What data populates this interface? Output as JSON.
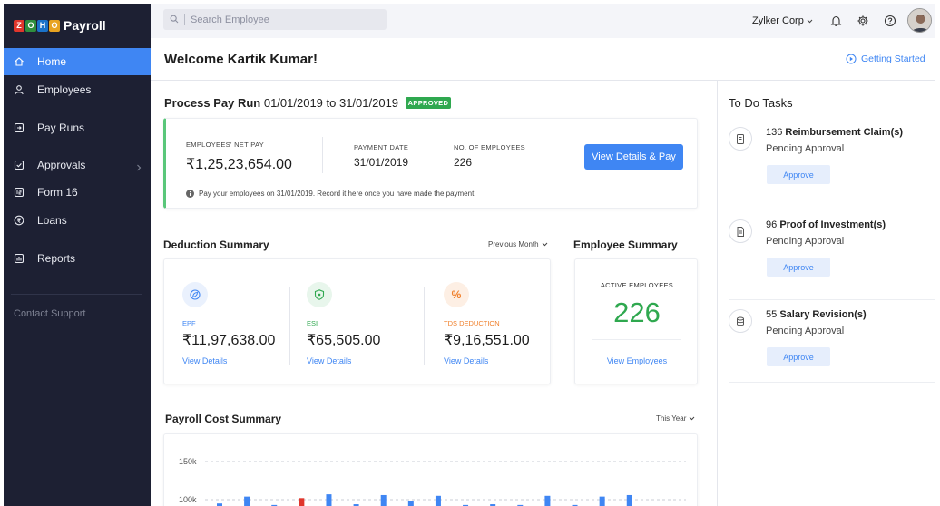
{
  "brand": {
    "logo_letters": [
      "Z",
      "O",
      "H",
      "O"
    ],
    "logo_colors": [
      "#e0362c",
      "#2f8e3e",
      "#1b72c9",
      "#e8a321"
    ],
    "app_name": "Payroll"
  },
  "sidebar": {
    "items": [
      {
        "label": "Home",
        "icon": "home-icon",
        "active": true
      },
      {
        "label": "Employees",
        "icon": "person-icon"
      },
      {
        "label": "Pay Runs",
        "icon": "payrun-icon"
      },
      {
        "label": "Approvals",
        "icon": "checkbox-icon",
        "has_submenu": true
      },
      {
        "label": "Form 16",
        "icon": "form-icon"
      },
      {
        "label": "Loans",
        "icon": "rupee-icon"
      },
      {
        "label": "Reports",
        "icon": "chart-icon"
      }
    ],
    "contact_support": "Contact Support"
  },
  "topbar": {
    "search_placeholder": "Search Employee",
    "organization": "Zylker Corp"
  },
  "header": {
    "welcome": "Welcome Kartik Kumar!",
    "getting_started": "Getting Started"
  },
  "pay_run": {
    "title": "Process Pay Run",
    "period": "01/01/2019 to 31/01/2019",
    "status": "APPROVED",
    "net_pay_label": "EMPLOYEES' NET PAY",
    "net_pay": "₹1,25,23,654.00",
    "payment_date_label": "PAYMENT DATE",
    "payment_date": "31/01/2019",
    "employees_label": "NO. OF EMPLOYEES",
    "employees": "226",
    "action": "View Details & Pay",
    "note": "Pay your employees on 31/01/2019. Record it here once you have made the payment."
  },
  "deduction_summary": {
    "title": "Deduction Summary",
    "period": "Previous Month",
    "items": [
      {
        "name": "EPF",
        "amount": "₹11,97,638.00",
        "link": "View Details",
        "color": "#3f86f3",
        "icon_bg": "#eaf1fd"
      },
      {
        "name": "ESI",
        "amount": "₹65,505.00",
        "link": "View Details",
        "color": "#2fa84f",
        "icon_bg": "#e8f6ec"
      },
      {
        "name": "TDS DEDUCTION",
        "amount": "₹9,16,551.00",
        "link": "View Details",
        "color": "#f0802c",
        "icon_bg": "#fdefe4"
      }
    ]
  },
  "employee_summary": {
    "title": "Employee Summary",
    "label": "ACTIVE EMPLOYEES",
    "count": "226",
    "link": "View Employees"
  },
  "payroll_cost": {
    "title": "Payroll Cost Summary",
    "period": "This Year"
  },
  "chart_data": {
    "type": "bar",
    "title": "Payroll Cost Summary",
    "y_tick_labels": [
      "150k",
      "100k"
    ],
    "ylim": [
      100000,
      150000
    ],
    "values": [
      95000,
      104000,
      93000,
      102000,
      107000,
      94000,
      106000,
      98000,
      105000,
      93000,
      94000,
      93000,
      105000,
      93000,
      104000,
      106000,
      91000
    ],
    "colors": [
      "#3f86f3",
      "#3f86f3",
      "#3f86f3",
      "#e0362c",
      "#3f86f3",
      "#3f86f3",
      "#3f86f3",
      "#3f86f3",
      "#3f86f3",
      "#3f86f3",
      "#3f86f3",
      "#3f86f3",
      "#3f86f3",
      "#3f86f3",
      "#3f86f3",
      "#3f86f3",
      "#3f86f3"
    ],
    "grid": true
  },
  "todo": {
    "title": "To Do Tasks",
    "tasks": [
      {
        "count": "136",
        "name": "Reimbursement Claim(s)",
        "status": "Pending Approval",
        "action": "Approve",
        "icon": "receipt-icon"
      },
      {
        "count": "96",
        "name": "Proof of Investment(s)",
        "status": "Pending Approval",
        "action": "Approve",
        "icon": "document-icon"
      },
      {
        "count": "55",
        "name": "Salary Revision(s)",
        "status": "Pending Approval",
        "action": "Approve",
        "icon": "coins-icon"
      }
    ]
  }
}
